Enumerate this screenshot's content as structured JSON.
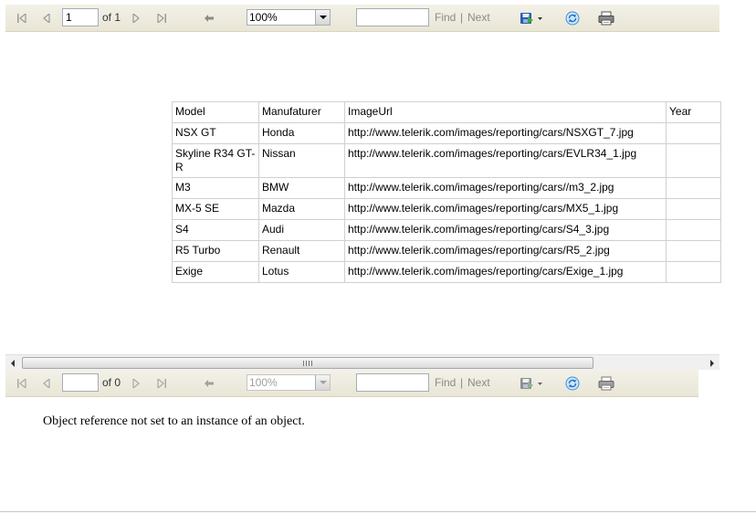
{
  "toolbar_top": {
    "page_value": "1",
    "page_of": "of 1",
    "zoom": "100%",
    "search_value": "",
    "find_label": "Find",
    "separator": "|",
    "next_label": "Next"
  },
  "toolbar_bottom": {
    "page_value": "",
    "page_of": "of 0",
    "zoom": "100%",
    "search_value": "",
    "find_label": "Find",
    "separator": "|",
    "next_label": "Next"
  },
  "report_table": {
    "headers": [
      "Model",
      "Manufaturer",
      "ImageUrl",
      "Year"
    ],
    "rows": [
      [
        "NSX GT",
        "Honda",
        "http://www.telerik.com/images/reporting/cars/NSXGT_7.jpg",
        ""
      ],
      [
        "Skyline R34 GT-R",
        "Nissan",
        "http://www.telerik.com/images/reporting/cars/EVLR34_1.jpg",
        ""
      ],
      [
        "M3",
        "BMW",
        "http://www.telerik.com/images/reporting/cars//m3_2.jpg",
        ""
      ],
      [
        "MX-5 SE",
        "Mazda",
        "http://www.telerik.com/images/reporting/cars/MX5_1.jpg",
        ""
      ],
      [
        "S4",
        "Audi",
        "http://www.telerik.com/images/reporting/cars/S4_3.jpg",
        ""
      ],
      [
        "R5 Turbo",
        "Renault",
        "http://www.telerik.com/images/reporting/cars/R5_2.jpg",
        ""
      ],
      [
        "Exige",
        "Lotus",
        "http://www.telerik.com/images/reporting/cars/Exige_1.jpg",
        ""
      ]
    ]
  },
  "error_message": "Object reference not set to an instance of an object.",
  "icons": {
    "first_page": "first-page-icon",
    "previous_page": "previous-page-icon",
    "next_page": "next-page-icon",
    "last_page": "last-page-icon",
    "back": "back-icon",
    "export": "export-disk-icon",
    "refresh": "refresh-icon",
    "print": "printer-icon"
  },
  "colors": {
    "toolbar_bg": "#ece9d8",
    "link_gray": "#8a8a8a",
    "export_blue": "#2a5db0",
    "refresh_blue": "#3a8fd8"
  }
}
